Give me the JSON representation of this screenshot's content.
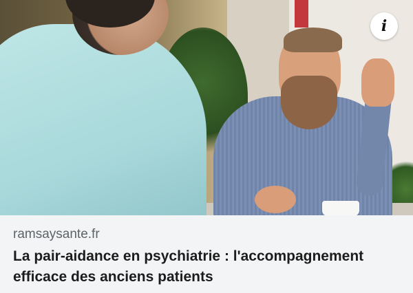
{
  "article": {
    "image_alt": "Deux hommes discutant à une table de café",
    "info_icon": "info-icon",
    "info_glyph": "i",
    "source_domain": "ramsaysante.fr",
    "headline": "La pair-aidance en psychiatrie : l'accompagnement efficace des anciens patients"
  }
}
